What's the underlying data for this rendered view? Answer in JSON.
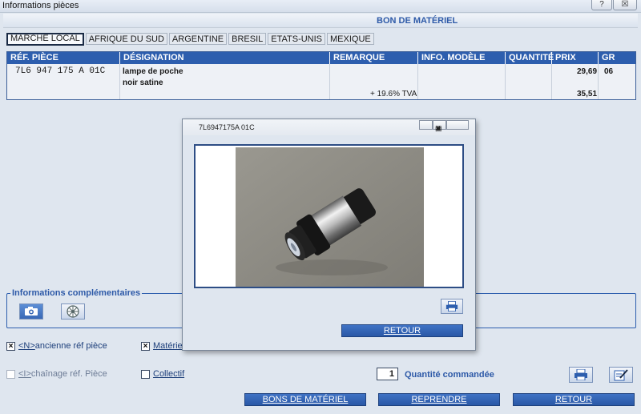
{
  "window": {
    "title": "Informations pièces",
    "help_label": "?",
    "close_label": "☒"
  },
  "header": {
    "title": "BON DE MATÉRIEL"
  },
  "tabs": [
    {
      "label": "MARCHE LOCAL"
    },
    {
      "label": "AFRIQUE DU SUD"
    },
    {
      "label": "ARGENTINE"
    },
    {
      "label": "BRESIL"
    },
    {
      "label": "ETATS-UNIS"
    },
    {
      "label": "MEXIQUE"
    }
  ],
  "table": {
    "columns": [
      "RÉF. PIÈCE",
      "DÉSIGNATION",
      "REMARQUE",
      "INFO. MODÈLE",
      "QUANTITÉ",
      "PRIX",
      "GR"
    ],
    "row": {
      "ref": "7L6 947 175 A  01C",
      "designation_line1": "lampe de poche",
      "designation_line2": "noir satine",
      "price": "29,69",
      "gr": "06",
      "tax_label": "+ 19.6% TVA",
      "price_ttc": "35,51"
    }
  },
  "info_section": {
    "title": "Informations complémentaires",
    "camera_icon": "camera-icon",
    "wheel_icon": "wheel-icon"
  },
  "options": {
    "old_ref": {
      "prefix": "<N>",
      "label": " ancienne réf pièce",
      "checked": true
    },
    "materiel": {
      "label": "Matérie",
      "checked": true
    },
    "chain": {
      "prefix": "<I>",
      "label": " chaînage réf. Pièce",
      "checked": false
    },
    "collectif": {
      "label": "Collectif",
      "checked": false
    }
  },
  "quantity": {
    "value": "1",
    "label": "Quantité commandée"
  },
  "buttons": {
    "bons": "BONS DE MATÉRIEL",
    "reprendre": "REPRENDRE",
    "retour": "RETOUR"
  },
  "dialog": {
    "title": "7L6947175A 01C",
    "retour_label": "RETOUR",
    "print_icon": "printer-icon"
  },
  "colors": {
    "accent_blue": "#2d5eae",
    "header_text": "#2e5aa8"
  }
}
